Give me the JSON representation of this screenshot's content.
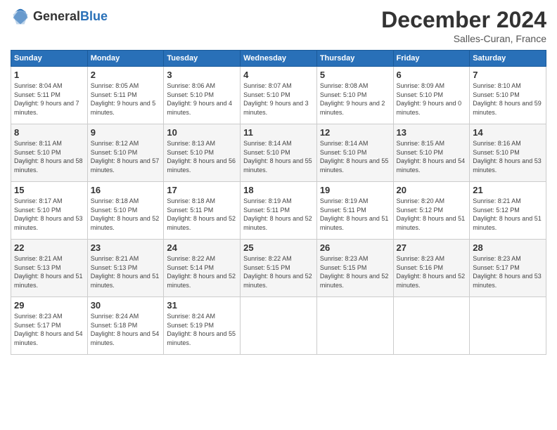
{
  "header": {
    "logo_general": "General",
    "logo_blue": "Blue",
    "month_year": "December 2024",
    "location": "Salles-Curan, France"
  },
  "weekdays": [
    "Sunday",
    "Monday",
    "Tuesday",
    "Wednesday",
    "Thursday",
    "Friday",
    "Saturday"
  ],
  "weeks": [
    [
      {
        "day": "1",
        "sunrise": "8:04 AM",
        "sunset": "5:11 PM",
        "daylight": "9 hours and 7 minutes."
      },
      {
        "day": "2",
        "sunrise": "8:05 AM",
        "sunset": "5:11 PM",
        "daylight": "9 hours and 5 minutes."
      },
      {
        "day": "3",
        "sunrise": "8:06 AM",
        "sunset": "5:10 PM",
        "daylight": "9 hours and 4 minutes."
      },
      {
        "day": "4",
        "sunrise": "8:07 AM",
        "sunset": "5:10 PM",
        "daylight": "9 hours and 3 minutes."
      },
      {
        "day": "5",
        "sunrise": "8:08 AM",
        "sunset": "5:10 PM",
        "daylight": "9 hours and 2 minutes."
      },
      {
        "day": "6",
        "sunrise": "8:09 AM",
        "sunset": "5:10 PM",
        "daylight": "9 hours and 0 minutes."
      },
      {
        "day": "7",
        "sunrise": "8:10 AM",
        "sunset": "5:10 PM",
        "daylight": "8 hours and 59 minutes."
      }
    ],
    [
      {
        "day": "8",
        "sunrise": "8:11 AM",
        "sunset": "5:10 PM",
        "daylight": "8 hours and 58 minutes."
      },
      {
        "day": "9",
        "sunrise": "8:12 AM",
        "sunset": "5:10 PM",
        "daylight": "8 hours and 57 minutes."
      },
      {
        "day": "10",
        "sunrise": "8:13 AM",
        "sunset": "5:10 PM",
        "daylight": "8 hours and 56 minutes."
      },
      {
        "day": "11",
        "sunrise": "8:14 AM",
        "sunset": "5:10 PM",
        "daylight": "8 hours and 55 minutes."
      },
      {
        "day": "12",
        "sunrise": "8:14 AM",
        "sunset": "5:10 PM",
        "daylight": "8 hours and 55 minutes."
      },
      {
        "day": "13",
        "sunrise": "8:15 AM",
        "sunset": "5:10 PM",
        "daylight": "8 hours and 54 minutes."
      },
      {
        "day": "14",
        "sunrise": "8:16 AM",
        "sunset": "5:10 PM",
        "daylight": "8 hours and 53 minutes."
      }
    ],
    [
      {
        "day": "15",
        "sunrise": "8:17 AM",
        "sunset": "5:10 PM",
        "daylight": "8 hours and 53 minutes."
      },
      {
        "day": "16",
        "sunrise": "8:18 AM",
        "sunset": "5:10 PM",
        "daylight": "8 hours and 52 minutes."
      },
      {
        "day": "17",
        "sunrise": "8:18 AM",
        "sunset": "5:11 PM",
        "daylight": "8 hours and 52 minutes."
      },
      {
        "day": "18",
        "sunrise": "8:19 AM",
        "sunset": "5:11 PM",
        "daylight": "8 hours and 52 minutes."
      },
      {
        "day": "19",
        "sunrise": "8:19 AM",
        "sunset": "5:11 PM",
        "daylight": "8 hours and 51 minutes."
      },
      {
        "day": "20",
        "sunrise": "8:20 AM",
        "sunset": "5:12 PM",
        "daylight": "8 hours and 51 minutes."
      },
      {
        "day": "21",
        "sunrise": "8:21 AM",
        "sunset": "5:12 PM",
        "daylight": "8 hours and 51 minutes."
      }
    ],
    [
      {
        "day": "22",
        "sunrise": "8:21 AM",
        "sunset": "5:13 PM",
        "daylight": "8 hours and 51 minutes."
      },
      {
        "day": "23",
        "sunrise": "8:21 AM",
        "sunset": "5:13 PM",
        "daylight": "8 hours and 51 minutes."
      },
      {
        "day": "24",
        "sunrise": "8:22 AM",
        "sunset": "5:14 PM",
        "daylight": "8 hours and 52 minutes."
      },
      {
        "day": "25",
        "sunrise": "8:22 AM",
        "sunset": "5:15 PM",
        "daylight": "8 hours and 52 minutes."
      },
      {
        "day": "26",
        "sunrise": "8:23 AM",
        "sunset": "5:15 PM",
        "daylight": "8 hours and 52 minutes."
      },
      {
        "day": "27",
        "sunrise": "8:23 AM",
        "sunset": "5:16 PM",
        "daylight": "8 hours and 52 minutes."
      },
      {
        "day": "28",
        "sunrise": "8:23 AM",
        "sunset": "5:17 PM",
        "daylight": "8 hours and 53 minutes."
      }
    ],
    [
      {
        "day": "29",
        "sunrise": "8:23 AM",
        "sunset": "5:17 PM",
        "daylight": "8 hours and 54 minutes."
      },
      {
        "day": "30",
        "sunrise": "8:24 AM",
        "sunset": "5:18 PM",
        "daylight": "8 hours and 54 minutes."
      },
      {
        "day": "31",
        "sunrise": "8:24 AM",
        "sunset": "5:19 PM",
        "daylight": "8 hours and 55 minutes."
      },
      null,
      null,
      null,
      null
    ]
  ]
}
